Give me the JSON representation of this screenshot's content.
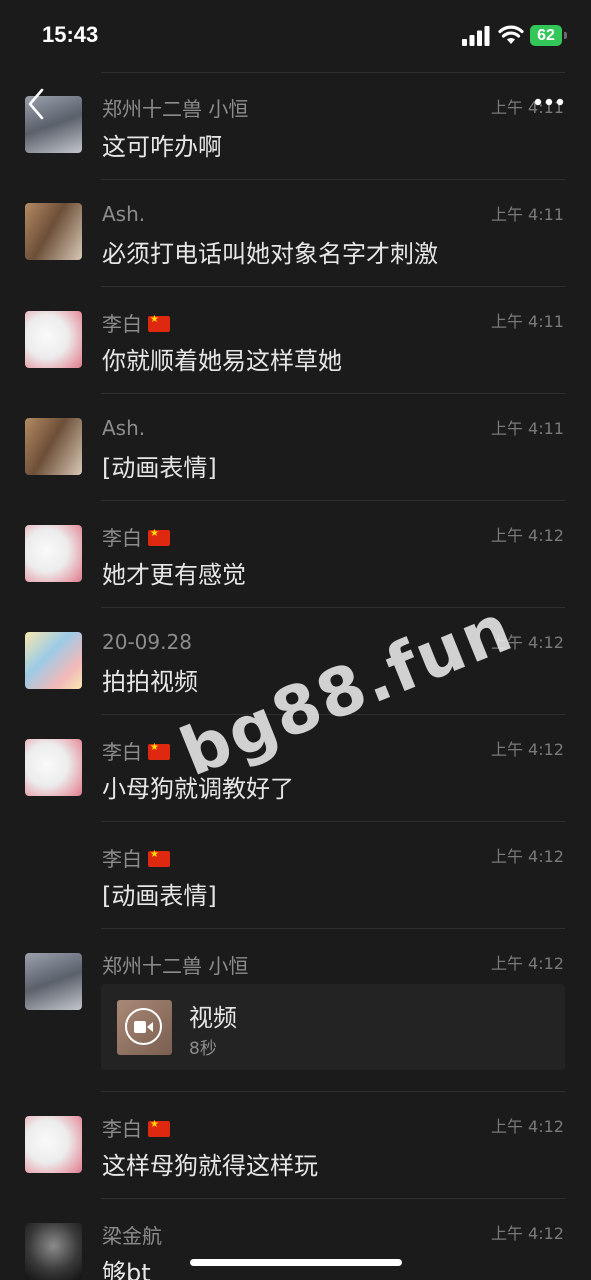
{
  "status_bar": {
    "time": "15:43",
    "battery": "62"
  },
  "messages": [
    {
      "sender": "郑州十二兽  小恒",
      "flag": false,
      "time": "上午 4:11",
      "text": "这可咋办啊"
    },
    {
      "sender": "Ash.",
      "flag": false,
      "time": "上午 4:11",
      "text": "必须打电话叫她对象名字才刺激"
    },
    {
      "sender": "李白",
      "flag": true,
      "time": "上午 4:11",
      "text": "你就顺着她易这样草她"
    },
    {
      "sender": "Ash.",
      "flag": false,
      "time": "上午 4:11",
      "text": "[动画表情]"
    },
    {
      "sender": "李白",
      "flag": true,
      "time": "上午 4:12",
      "text": "她才更有感觉"
    },
    {
      "sender": "20-09.28",
      "flag": false,
      "time": "上午 4:12",
      "text": "拍拍视频"
    },
    {
      "sender": "李白",
      "flag": true,
      "time": "上午 4:12",
      "text": "小母狗就调教好了"
    },
    {
      "sender": "李白",
      "flag": true,
      "time": "上午 4:12",
      "text": "[动画表情]"
    },
    {
      "sender": "郑州十二兽  小恒",
      "flag": false,
      "time": "上午 4:12",
      "video": {
        "title": "视频",
        "duration": "8秒"
      }
    },
    {
      "sender": "李白",
      "flag": true,
      "time": "上午 4:12",
      "text": "这样母狗就得这样玩"
    },
    {
      "sender": "梁金航",
      "flag": false,
      "time": "上午 4:12",
      "text": "够bt"
    }
  ],
  "watermark": "bg88.fun",
  "colors": {
    "background": "#1b1b1b",
    "battery": "#33c659",
    "flag_red": "#de2910"
  }
}
